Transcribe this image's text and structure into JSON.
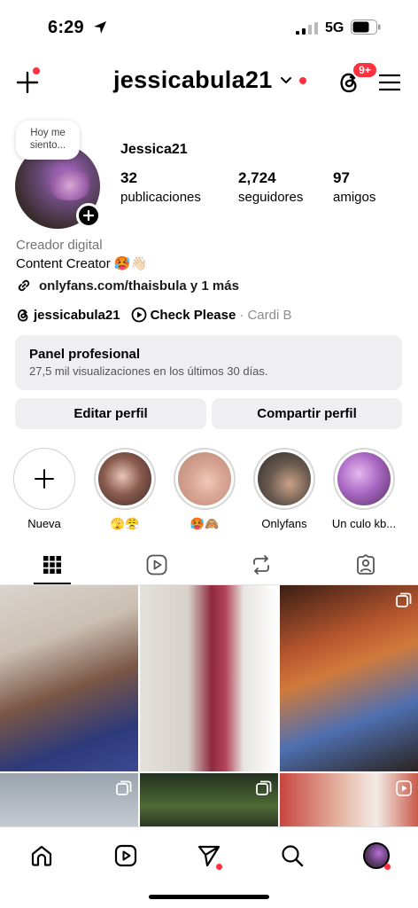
{
  "status_bar": {
    "time": "6:29",
    "network": "5G"
  },
  "top_nav": {
    "username": "jessicabula21",
    "notif_badge": "9+"
  },
  "profile": {
    "note": "Hoy me siento...",
    "display_name": "Jessica21",
    "stats": [
      {
        "value": "32",
        "label": "publicaciones"
      },
      {
        "value": "2,724",
        "label": "seguidores"
      },
      {
        "value": "97",
        "label": "amigos"
      }
    ],
    "category": "Creador digital",
    "bio": "Content Creator 🥵👋🏻",
    "link": "onlyfans.com/thaisbula y 1 más",
    "threads_handle": "jessicabula21",
    "music_title": "Check Please",
    "music_artist": "· Cardi B"
  },
  "panel": {
    "title": "Panel profesional",
    "subtitle": "27,5 mil visualizaciones en los últimos 30 días."
  },
  "buttons": {
    "edit": "Editar perfil",
    "share": "Compartir perfil"
  },
  "highlights": [
    {
      "label": "Nueva"
    },
    {
      "label": "🫣😤"
    },
    {
      "label": "🥵🙈"
    },
    {
      "label": "Onlyfans"
    },
    {
      "label": "Un culo kb..."
    }
  ],
  "colors": {
    "accent_red": "#ff3040",
    "panel_bg": "#efeff1",
    "muted_text": "#737373"
  },
  "icons": [
    "plus-icon",
    "chevron-down-icon",
    "threads-icon",
    "menu-icon",
    "link-icon",
    "play-circle-icon",
    "grid-icon",
    "reels-icon",
    "repost-icon",
    "tagged-icon",
    "home-icon",
    "direct-icon",
    "search-icon"
  ]
}
